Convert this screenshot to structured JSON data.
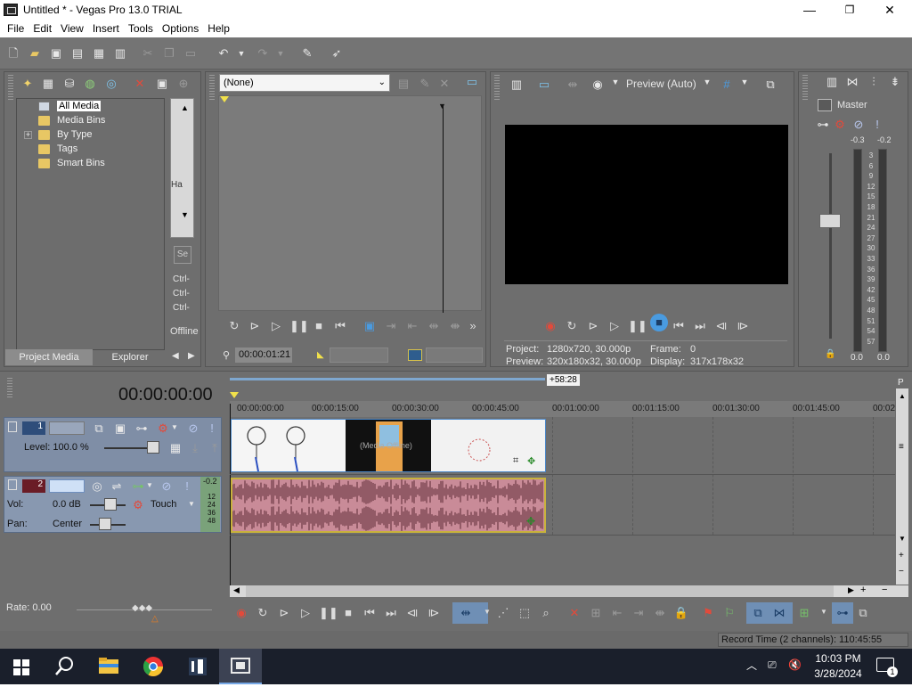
{
  "window": {
    "title": "Untitled * - Vegas Pro 13.0 TRIAL",
    "minimize": "—",
    "maximize": "❐",
    "close": "✕"
  },
  "menu": [
    "File",
    "Edit",
    "View",
    "Insert",
    "Tools",
    "Options",
    "Help"
  ],
  "explorer": {
    "items": [
      "All Media",
      "Media Bins",
      "By Type",
      "Tags",
      "Smart Bins"
    ],
    "expand_glyph": "+",
    "tabs": [
      "Project Media",
      "Explorer"
    ]
  },
  "side_panel": {
    "truncated_label": "Ha",
    "search_stub": "Se",
    "ctrl_items": [
      "Ctrl-",
      "Ctrl-",
      "Ctrl-"
    ],
    "offline": "Offline"
  },
  "trimmer": {
    "dropdown_value": "(None)",
    "timecode": "00:00:01:21"
  },
  "video_preview": {
    "mode": "Preview (Auto)",
    "project_label": "Project:",
    "project_value": "1280x720, 30.000p",
    "frame_label": "Frame:",
    "frame_value": "0",
    "preview_label": "Preview:",
    "preview_value": "320x180x32, 30.000p",
    "display_label": "Display:",
    "display_value": "317x178x32"
  },
  "master": {
    "label": "Master",
    "peak_left": "-0.3",
    "peak_right": "-0.2",
    "scale": [
      "3",
      "6",
      "9",
      "12",
      "15",
      "18",
      "21",
      "24",
      "27",
      "30",
      "33",
      "36",
      "39",
      "42",
      "45",
      "48",
      "51",
      "54",
      "57"
    ],
    "bottom_left": "0.0",
    "bottom_right": "0.0"
  },
  "timeline": {
    "time": "00:00:00:00",
    "end_marker": "+58:28",
    "ruler": [
      "00:00:00:00",
      "00:00:15:00",
      "00:00:30:00",
      "00:00:45:00",
      "00:01:00:00",
      "00:01:15:00",
      "00:01:30:00",
      "00:01:45:00",
      "00:02"
    ],
    "clip_label": "(Media Offline)"
  },
  "tracks": {
    "video": {
      "number": "1",
      "level": "Level: 100.0 %"
    },
    "audio": {
      "number": "2",
      "vol_label": "Vol:",
      "vol_value": "0.0 dB",
      "pan_label": "Pan:",
      "pan_value": "Center",
      "automation": "Touch",
      "peak": "-0.2",
      "mini_scale": [
        "12",
        "24",
        "36",
        "48"
      ]
    }
  },
  "rate": "Rate: 0.00",
  "status": "Record Time (2 channels): 110:45:55",
  "taskbar": {
    "time": "10:03 PM",
    "date": "3/28/2024",
    "notif_count": "1"
  },
  "colors": {
    "accent": "#4a9be0",
    "audio_clip": "#c98b98",
    "audio_wave": "#6e3a45",
    "selection": "#cfe0f6"
  }
}
